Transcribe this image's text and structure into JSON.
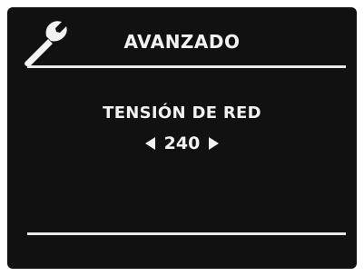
{
  "header": {
    "title": "AVANZADO",
    "icon": "wrench-icon"
  },
  "setting": {
    "label": "TENSIÓN DE RED",
    "value": "240",
    "decrease_icon": "left-arrow-icon",
    "increase_icon": "right-arrow-icon"
  },
  "colors": {
    "screen_background": "#111111",
    "foreground": "#f2f2f2"
  }
}
